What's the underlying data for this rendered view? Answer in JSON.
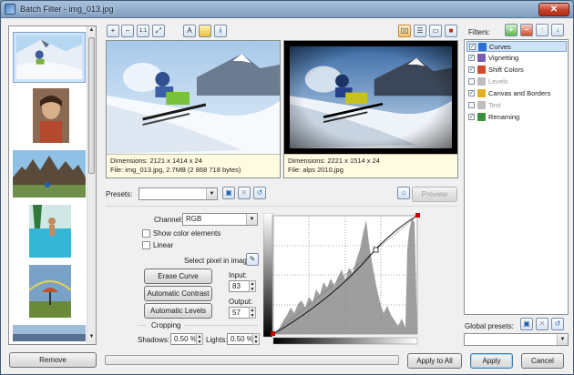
{
  "window": {
    "title": "Batch Filter - img_013.jpg",
    "close_icon": "close-icon"
  },
  "toolbar_icons": [
    "zoom-in-icon",
    "zoom-out-icon",
    "actual-size-icon",
    "fit-icon",
    "text-view-icon",
    "folder-icon",
    "info-icon"
  ],
  "view_icons": [
    "side-by-side-icon",
    "split-horizontal-icon",
    "single-view-icon",
    "stop-icon"
  ],
  "preview": {
    "original": {
      "dimensions": "Dimensions: 2121 x 1414 x 24",
      "file": "File: img_013.jpg, 2.7MB (2 868 718 bytes)"
    },
    "result": {
      "dimensions": "Dimensions: 2221 x 1514 x 24",
      "file": "File: alps 2010.jpg"
    }
  },
  "presets": {
    "label": "Presets:",
    "value": "",
    "preview_button": "Preview"
  },
  "curves": {
    "channel_label": "Channel:",
    "channel_value": "RGB",
    "show_color_elements": "Show color elements",
    "show_color_checked": false,
    "linear": "Linear",
    "linear_checked": false,
    "select_pixel": "Select pixel in image:",
    "erase_curve": "Erase Curve",
    "automatic_contrast": "Automatic Contrast",
    "automatic_levels": "Automatic Levels",
    "input_label": "Input:",
    "input_value": "83",
    "output_label": "Output:",
    "output_value": "57",
    "cropping_label": "Cropping",
    "shadows_label": "Shadows:",
    "shadows_value": "0.50 %",
    "lights_label": "Lights:",
    "lights_value": "0.50 %"
  },
  "filters": {
    "label": "Filters:",
    "items": [
      {
        "name": "Curves",
        "checked": true,
        "enabled": true,
        "color": "#2a6fd1"
      },
      {
        "name": "Vignetting",
        "checked": true,
        "enabled": true,
        "color": "#7a5bb5"
      },
      {
        "name": "Shift Colors",
        "checked": true,
        "enabled": true,
        "color": "#d34a2a"
      },
      {
        "name": "Levels",
        "checked": false,
        "enabled": false,
        "color": "#bdbdbd"
      },
      {
        "name": "Canvas and Borders",
        "checked": true,
        "enabled": true,
        "color": "#e0b020"
      },
      {
        "name": "Text",
        "checked": false,
        "enabled": false,
        "color": "#bdbdbd"
      },
      {
        "name": "Renaming",
        "checked": true,
        "enabled": true,
        "color": "#3a8f3a"
      }
    ]
  },
  "global_presets": {
    "label": "Global presets:",
    "value": ""
  },
  "bottom": {
    "remove": "Remove",
    "apply_to_all": "Apply to All",
    "apply": "Apply",
    "cancel": "Cancel"
  }
}
